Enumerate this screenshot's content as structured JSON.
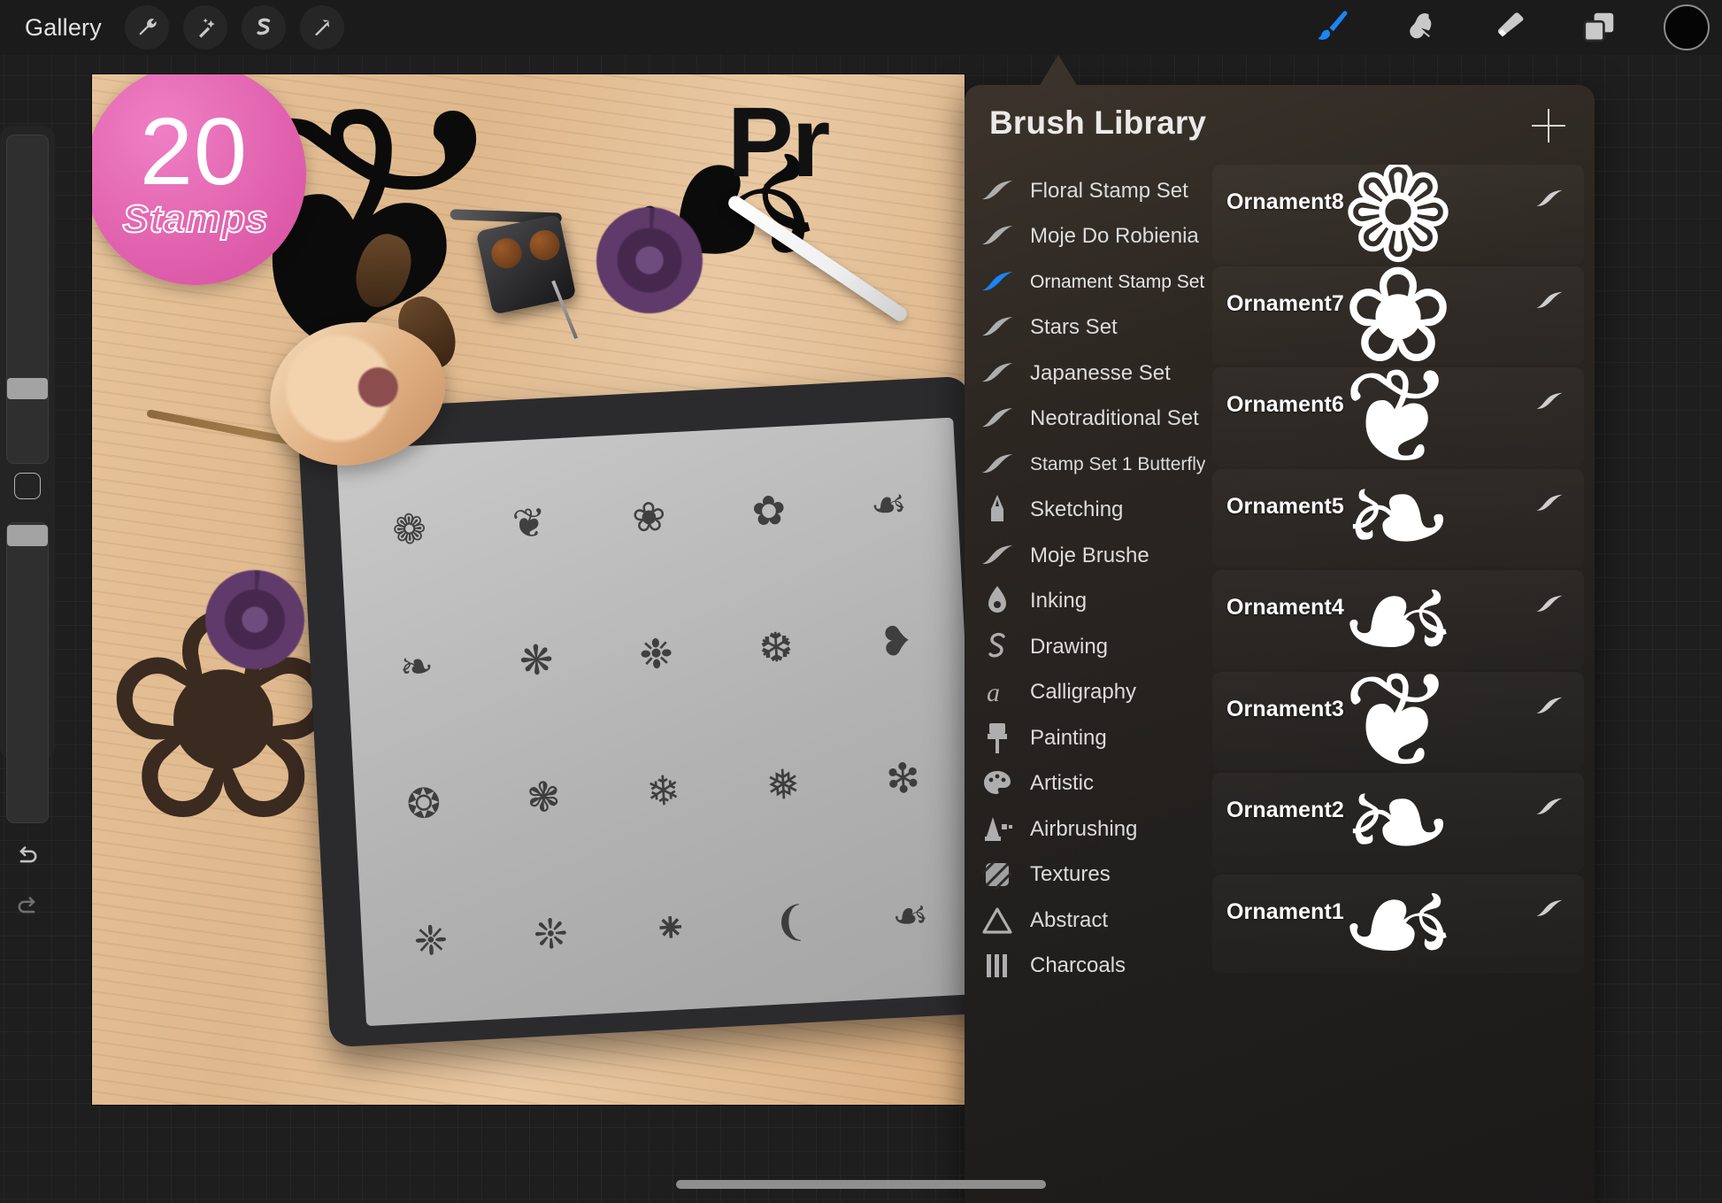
{
  "app": {
    "accent_color": "#1a85f5",
    "panel_bg": "#2e2a25",
    "badge_color": "#e061ad"
  },
  "topbar": {
    "gallery_label": "Gallery",
    "left_tools": [
      {
        "name": "actions-wrench-icon",
        "label": "Actions"
      },
      {
        "name": "adjustments-wand-icon",
        "label": "Adjustments"
      },
      {
        "name": "selection-icon",
        "label": "Selection"
      },
      {
        "name": "transform-arrow-icon",
        "label": "Transform"
      }
    ],
    "right_tools": [
      {
        "name": "paint-brush-icon",
        "label": "Paint",
        "active": true
      },
      {
        "name": "smudge-icon",
        "label": "Smudge",
        "active": false
      },
      {
        "name": "eraser-icon",
        "label": "Erase",
        "active": false
      },
      {
        "name": "layers-icon",
        "label": "Layers",
        "active": false
      }
    ],
    "color_swatch": "#050505"
  },
  "sidebar": {
    "brush_size_label": "Brush Size",
    "brush_opacity_label": "Brush Opacity",
    "modify_button_label": "Modify",
    "undo_label": "Undo",
    "redo_label": "Redo"
  },
  "canvas": {
    "title_text": "Pr",
    "badge_number": "20",
    "badge_label": "Stamps",
    "stamp_glyphs": [
      "❁",
      "❦",
      "❀",
      "✿",
      "☙",
      "❧",
      "❋",
      "❉",
      "❆",
      "❥",
      "❂",
      "❃",
      "❄",
      "❅",
      "❇",
      "❈",
      "❊",
      "⁕",
      "❨",
      "☙"
    ],
    "lineart_glyphs": [
      "❦",
      "☙",
      "❀"
    ]
  },
  "panel": {
    "title": "Brush Library",
    "add_button_label": "+",
    "sets": [
      {
        "label": "Floral Stamp Set",
        "icon": "brush-stroke-icon",
        "active": false,
        "small": false
      },
      {
        "label": "Moje Do Robienia",
        "icon": "brush-stroke-icon",
        "active": false,
        "small": false
      },
      {
        "label": "Ornament Stamp Set",
        "icon": "brush-stroke-icon",
        "active": true,
        "small": true
      },
      {
        "label": "Stars Set",
        "icon": "brush-stroke-icon",
        "active": false,
        "small": false
      },
      {
        "label": "Japanesse Set",
        "icon": "brush-stroke-icon",
        "active": false,
        "small": false
      },
      {
        "label": "Neotraditional Set",
        "icon": "brush-stroke-icon",
        "active": false,
        "small": false
      },
      {
        "label": "Stamp Set 1 Butterfly",
        "icon": "brush-stroke-icon",
        "active": false,
        "small": true
      },
      {
        "label": "Sketching",
        "icon": "pencil-tip-icon",
        "active": false,
        "small": false
      },
      {
        "label": "Moje Brushe",
        "icon": "brush-stroke-icon",
        "active": false,
        "small": false
      },
      {
        "label": "Inking",
        "icon": "nib-icon",
        "active": false,
        "small": false
      },
      {
        "label": "Drawing",
        "icon": "squiggle-icon",
        "active": false,
        "small": false
      },
      {
        "label": "Calligraphy",
        "icon": "letter-a-icon",
        "active": false,
        "small": false
      },
      {
        "label": "Painting",
        "icon": "paintbrush-icon",
        "active": false,
        "small": false
      },
      {
        "label": "Artistic",
        "icon": "palette-icon",
        "active": false,
        "small": false
      },
      {
        "label": "Airbrushing",
        "icon": "airbrush-icon",
        "active": false,
        "small": false
      },
      {
        "label": "Textures",
        "icon": "hatching-icon",
        "active": false,
        "small": false
      },
      {
        "label": "Abstract",
        "icon": "triangle-icon",
        "active": false,
        "small": false
      },
      {
        "label": "Charcoals",
        "icon": "charcoal-bars-icon",
        "active": false,
        "small": false
      }
    ],
    "brushes": [
      {
        "name": "Ornament8",
        "stamp": "❁"
      },
      {
        "name": "Ornament7",
        "stamp": "❀"
      },
      {
        "name": "Ornament6",
        "stamp": "❦"
      },
      {
        "name": "Ornament5",
        "stamp": "❧"
      },
      {
        "name": "Ornament4",
        "stamp": "☙"
      },
      {
        "name": "Ornament3",
        "stamp": "❦"
      },
      {
        "name": "Ornament2",
        "stamp": "❧"
      },
      {
        "name": "Ornament1",
        "stamp": "☙"
      }
    ]
  }
}
